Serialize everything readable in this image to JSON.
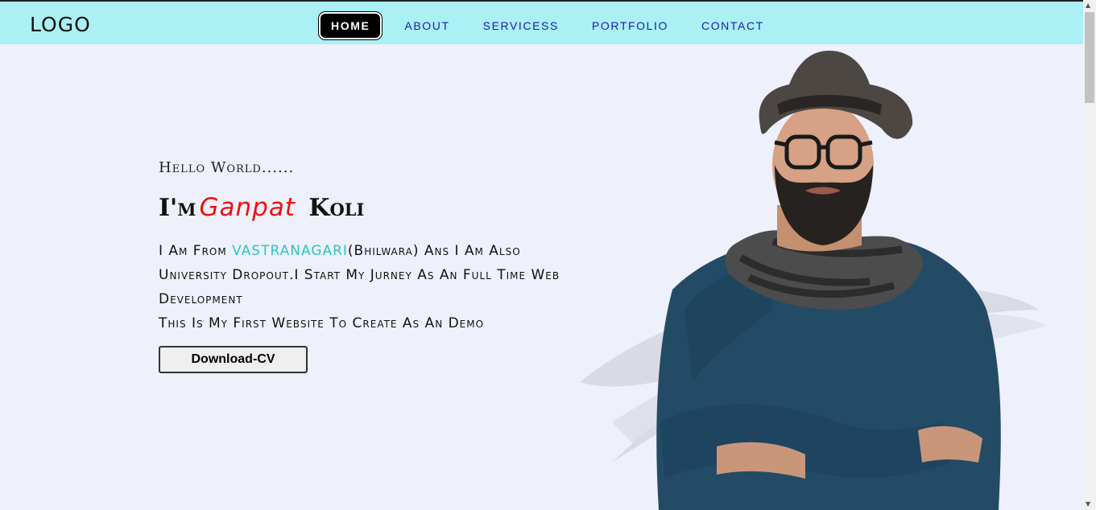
{
  "logo": "LOGO",
  "nav": {
    "items": [
      {
        "label": "HOME",
        "active": true
      },
      {
        "label": "ABOUT",
        "active": false
      },
      {
        "label": "SERVICESS",
        "active": false
      },
      {
        "label": "PORTFOLIO",
        "active": false
      },
      {
        "label": "CONTACT",
        "active": false
      }
    ]
  },
  "hero": {
    "greeting": "Hello World......",
    "name_prefix": "I'm",
    "name_first": "Ganpat",
    "name_last": "Koli",
    "desc_part1": "I Am From ",
    "desc_place": "VASTRANAGARI",
    "desc_part2": "(Bhilwara) Ans I Am Also University Dropout.I Start My Jurney As An Full Time Web Development",
    "desc_line4": "This Is My First Website To Create As An Demo",
    "cv_button": "Download-CV"
  },
  "colors": {
    "navbar": "#aaf0f4",
    "background": "#eef0fb",
    "accent_name": "#ee1111",
    "accent_place": "#2cc5c0",
    "nav_link": "#1a1ab8"
  }
}
